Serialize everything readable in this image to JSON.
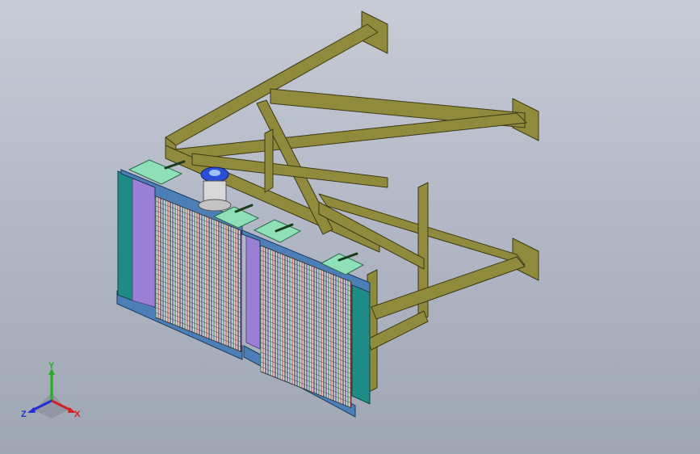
{
  "viewport": {
    "background_top": "#c7ccd6",
    "background_bottom": "#9fa6b4"
  },
  "model": {
    "frame_color": "#8f8a3c",
    "frame_edge_color": "#3c3a14",
    "panel_outer_color": "#4c7fb8",
    "panel_side_teal": "#1e8b87",
    "panel_side_purple": "#9a7fd6",
    "mount_plate_color": "#8fe0b8",
    "mesh_colors": [
      "#2a7a3a",
      "#c23a3a",
      "#222222",
      "#2a2a8a"
    ],
    "valve_color": "#2a4fd6"
  },
  "triad": {
    "x_label": "X",
    "y_label": "Y",
    "z_label": "Z",
    "x_color": "#d42020",
    "y_color": "#20b020",
    "z_color": "#2030d4"
  }
}
